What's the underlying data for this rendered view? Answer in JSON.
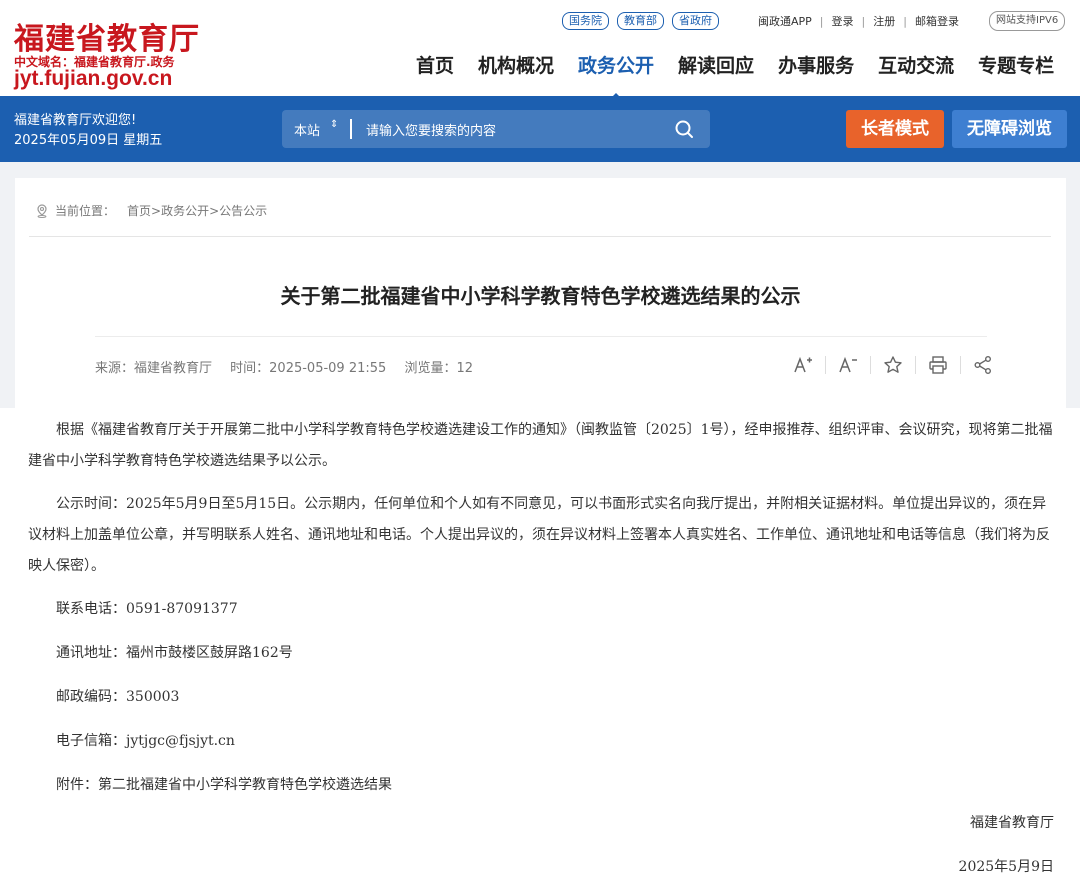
{
  "logo": {
    "title": "福建省教育厅",
    "subtitle": "中文域名：福建省教育厅.政务",
    "domain": "jyt.fujian.gov.cn"
  },
  "top_links": [
    "国务院",
    "教育部",
    "省政府"
  ],
  "top_right": {
    "app": "闽政通APP",
    "login": "登录",
    "register": "注册",
    "mail": "邮箱登录",
    "ipv6": "网站支持IPV6"
  },
  "nav": [
    "首页",
    "机构概况",
    "政务公开",
    "解读回应",
    "办事服务",
    "互动交流",
    "专题专栏"
  ],
  "bluebar": {
    "welcome": "福建省教育厅欢迎您!",
    "date": "2025年05月09日 星期五",
    "search_scope": "本站",
    "search_placeholder": "请输入您要搜索的内容",
    "elder_mode": "长者模式",
    "accessible": "无障碍浏览"
  },
  "breadcrumb": {
    "label": "当前位置：",
    "home": "首页",
    "level1": "政务公开",
    "level2": "公告公示"
  },
  "article": {
    "title": "关于第二批福建省中小学科学教育特色学校遴选结果的公示",
    "source": "来源：福建省教育厅",
    "time": "时间：2025-05-09 21:55",
    "views": "浏览量：12",
    "para1": "根据《福建省教育厅关于开展第二批中小学科学教育特色学校遴选建设工作的通知》（闽教监管〔2025〕1号），经申报推荐、组织评审、会议研究，现将第二批福建省中小学科学教育特色学校遴选结果予以公示。",
    "para2": "公示时间：2025年5月9日至5月15日。公示期内，任何单位和个人如有不同意见，可以书面形式实名向我厅提出，并附相关证据材料。单位提出异议的，须在异议材料上加盖单位公章，并写明联系人姓名、通讯地址和电话。个人提出异议的，须在异议材料上签署本人真实姓名、工作单位、通讯地址和电话等信息（我们将为反映人保密）。",
    "phone": "联系电话：0591-87091377",
    "address": "通讯地址：福州市鼓楼区鼓屏路162号",
    "postcode": "邮政编码：350003",
    "email": "电子信箱：jytjgc@fjsjyt.cn",
    "attachment": "附件：第二批福建省中小学科学教育特色学校遴选结果",
    "signature": "福建省教育厅",
    "sign_date": "2025年5月9日"
  },
  "colors": {
    "brand_red": "#c8171e",
    "brand_blue": "#1c5fb0",
    "elder_orange": "#e8632b",
    "access_blue": "#3e7fd1"
  }
}
